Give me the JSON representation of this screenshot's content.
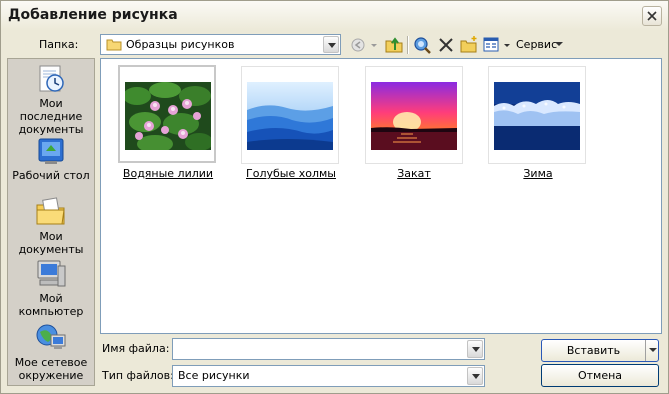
{
  "window": {
    "title": "Добавление рисунка"
  },
  "lookin": {
    "label": "Папка:",
    "value": "Образцы рисунков"
  },
  "toolbar": {
    "tools_label": "Сервис"
  },
  "places": [
    {
      "label": "Мои последние документы"
    },
    {
      "label": "Рабочий стол"
    },
    {
      "label": "Мои документы"
    },
    {
      "label": "Мой компьютер"
    },
    {
      "label": "Мое сетевое окружение"
    }
  ],
  "files": [
    {
      "name": "Водяные лилии",
      "selected": true
    },
    {
      "name": "Голубые холмы",
      "selected": false
    },
    {
      "name": "Закат",
      "selected": false
    },
    {
      "name": "Зима",
      "selected": false
    }
  ],
  "filename": {
    "label": "Имя файла:",
    "value": ""
  },
  "filetype": {
    "label": "Тип файлов:",
    "value": "Все рисунки"
  },
  "buttons": {
    "insert": "Вставить",
    "cancel": "Отмена"
  },
  "colors": {
    "selection_border": "#c8c8c8",
    "field_border": "#7f9db9",
    "dialog_bg": "#ece9d8"
  },
  "icons": {
    "close": "close-icon",
    "folder": "folder-icon",
    "back": "back-icon",
    "up": "up-folder-icon",
    "search": "search-web-icon",
    "delete": "delete-icon",
    "new_folder": "new-folder-icon",
    "views": "views-icon"
  }
}
